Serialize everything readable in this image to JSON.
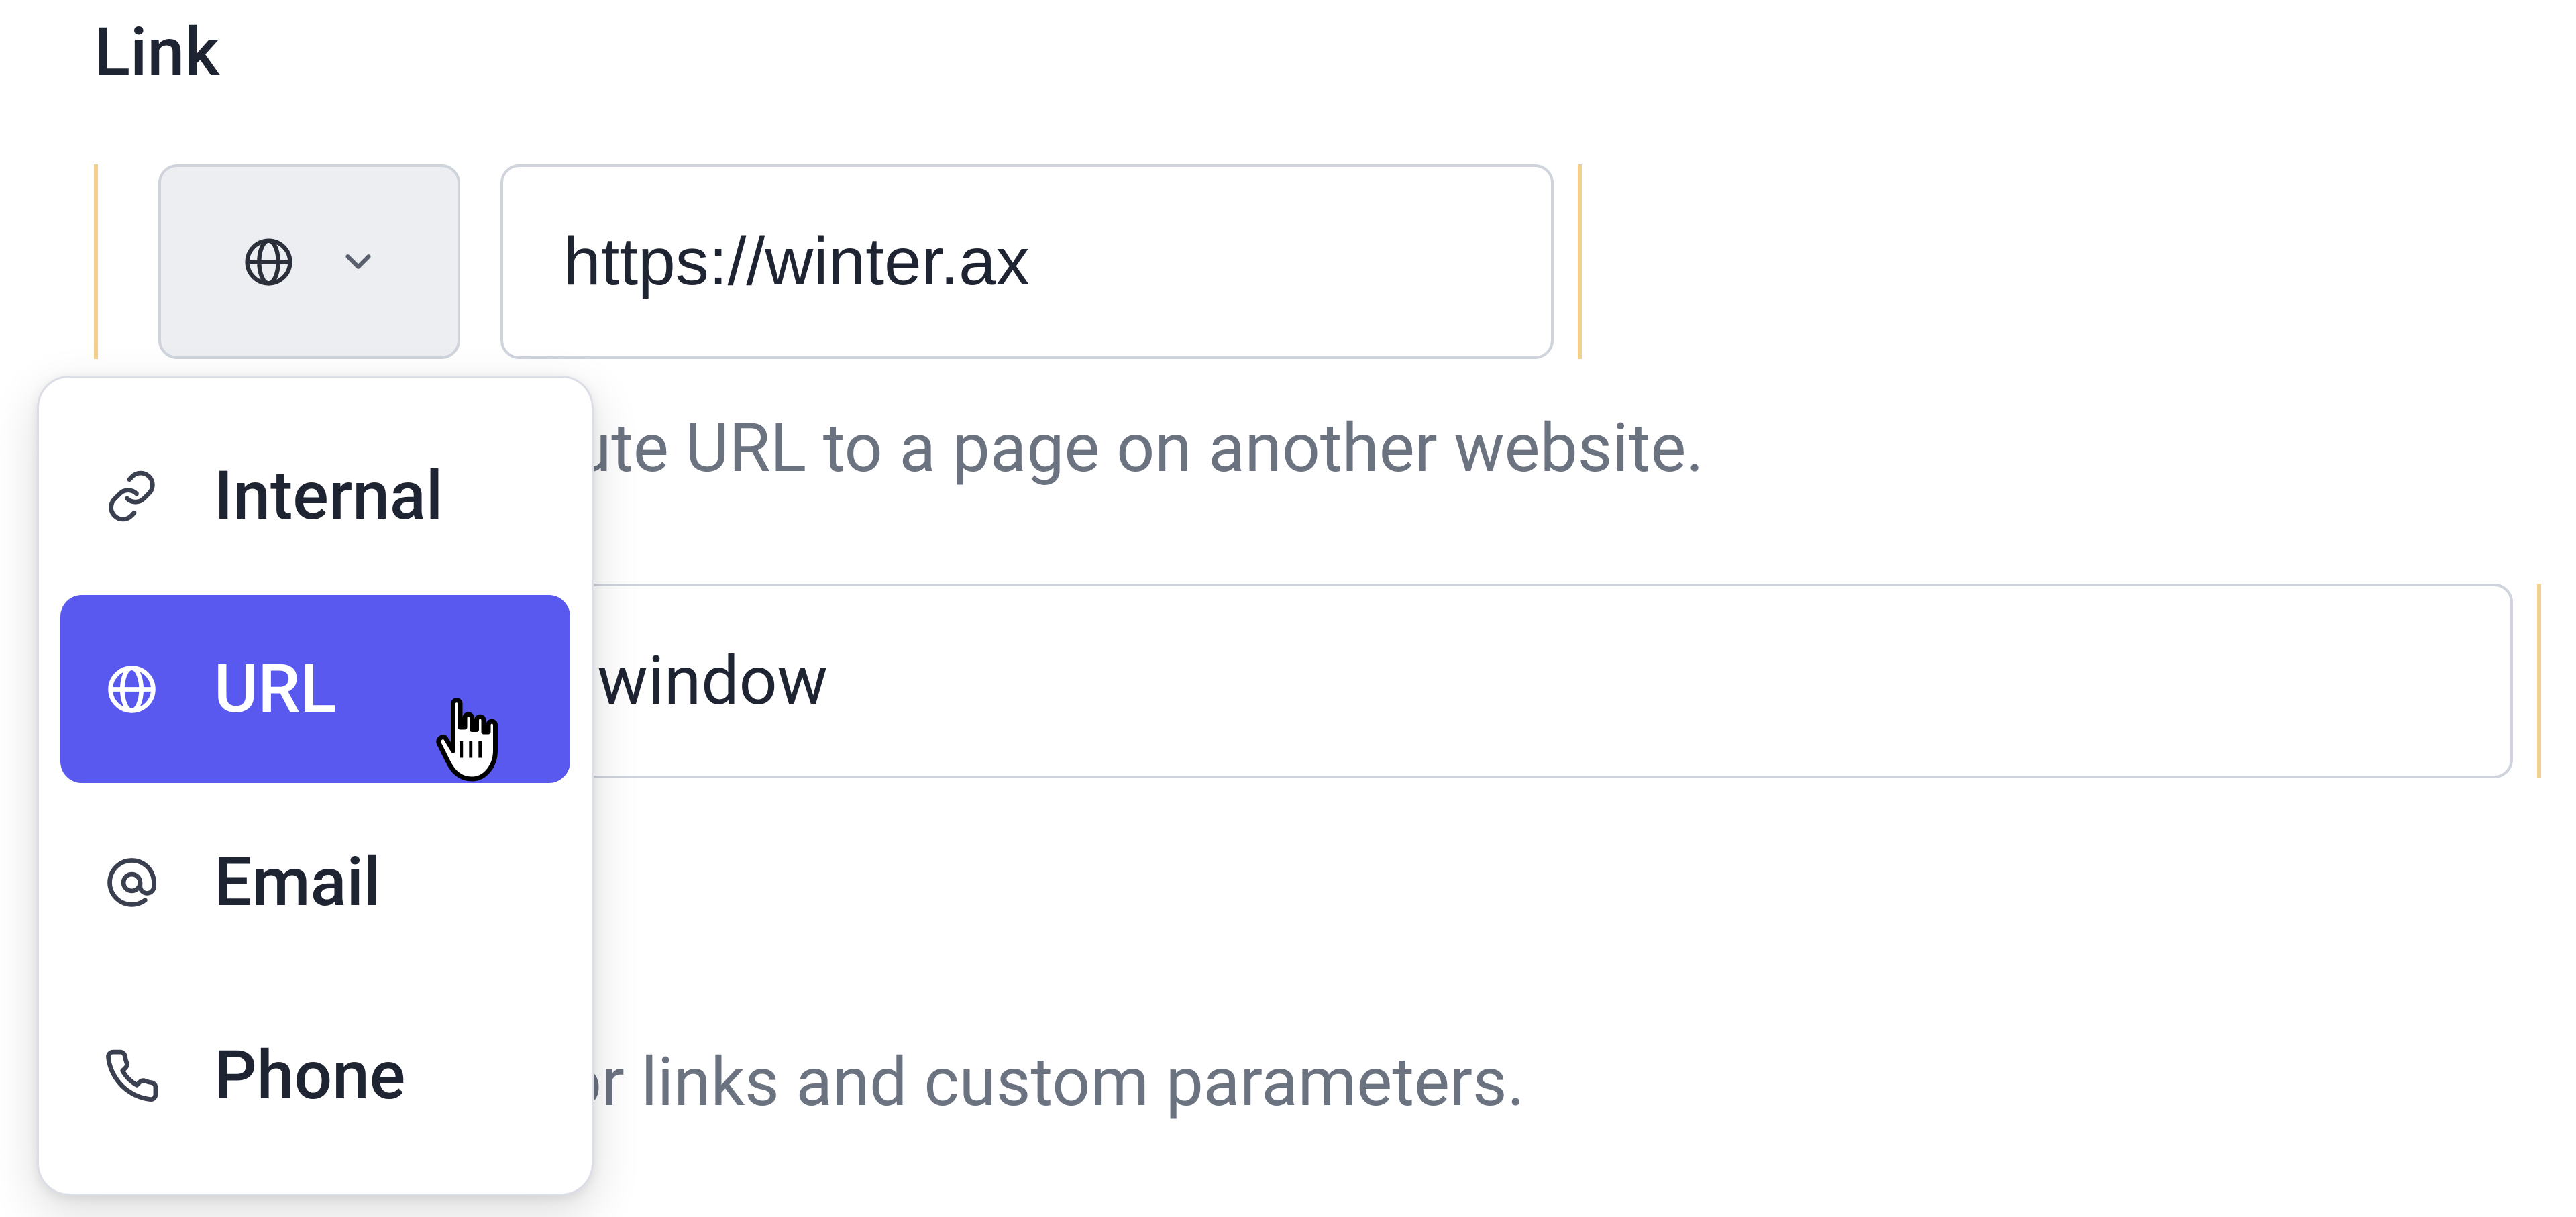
{
  "section_label": "Link",
  "link_type_selector": {
    "selected_icon": "globe-icon"
  },
  "url_field": {
    "value": "https://winter.ax",
    "placeholder": ""
  },
  "url_help_text": "The absolute URL to a page on another website.",
  "new_window_select": {
    "selected_label": "Open in new window"
  },
  "anchor_help_text": "Add anchor links and custom parameters.",
  "dropdown": {
    "items": [
      {
        "icon": "chain-link-icon",
        "label": "Internal",
        "selected": false
      },
      {
        "icon": "globe-icon",
        "label": "URL",
        "selected": true
      },
      {
        "icon": "at-sign-icon",
        "label": "Email",
        "selected": false
      },
      {
        "icon": "phone-icon",
        "label": "Phone",
        "selected": false
      }
    ]
  },
  "colors": {
    "accent": "#5959f0",
    "changed_marker": "#f2cf8d",
    "text": "#1f2433",
    "muted": "#6b7280",
    "border": "#cfd3db",
    "selector_bg": "#eceef2"
  }
}
